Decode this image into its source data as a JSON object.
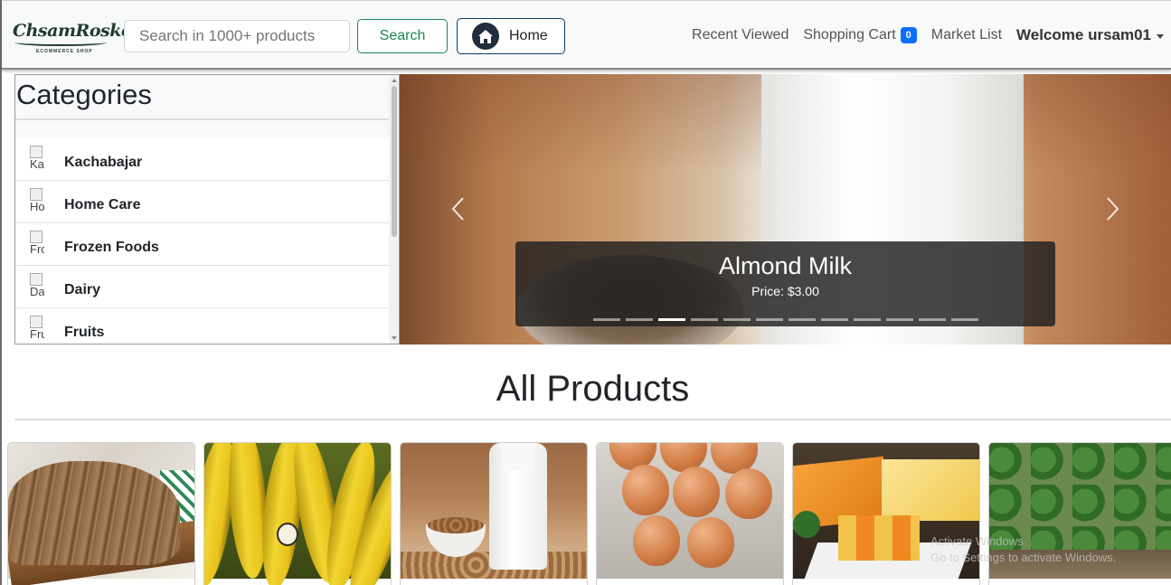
{
  "brand": {
    "logo_text": "ChsamRosko",
    "logo_subtitle": "ECOMMERCE SHOP"
  },
  "search": {
    "placeholder": "Search in 1000+ products",
    "button_label": "Search"
  },
  "home_button": {
    "label": "Home",
    "icon": "home-icon"
  },
  "nav": {
    "recent_viewed": "Recent Viewed",
    "shopping_cart": "Shopping Cart",
    "cart_count": "0",
    "market_list": "Market List",
    "welcome": "Welcome ursam01"
  },
  "categories": {
    "title": "Categories",
    "items": [
      {
        "label": "Kachabajar",
        "img_alt": "Kach"
      },
      {
        "label": "Home Care",
        "img_alt": "Hom"
      },
      {
        "label": "Frozen Foods",
        "img_alt": "Froz"
      },
      {
        "label": "Dairy",
        "img_alt": "Dair"
      },
      {
        "label": "Fruits",
        "img_alt": "Fruit"
      }
    ]
  },
  "carousel": {
    "title": "Almond Milk",
    "price": "Price: $3.00",
    "slide_count": 12,
    "active_index": 2
  },
  "all_products": {
    "title": "All Products",
    "items": [
      {
        "name": "bread"
      },
      {
        "name": "banana"
      },
      {
        "name": "almond-milk"
      },
      {
        "name": "eggs"
      },
      {
        "name": "cheese"
      },
      {
        "name": "spinach"
      }
    ]
  },
  "watermark": {
    "line1": "Activate Windows",
    "line2": "Go to Settings to activate Windows."
  },
  "colors": {
    "success": "#198754",
    "primary": "#0d6efd",
    "navy": "#0d3b66"
  }
}
